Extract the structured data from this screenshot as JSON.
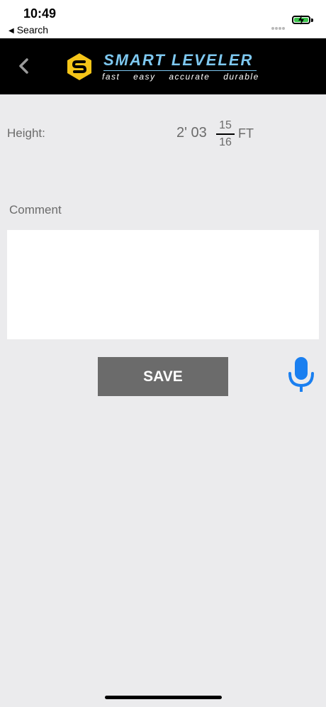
{
  "status_bar": {
    "time": "10:49",
    "back_app_label": "Search",
    "battery_color": "#3ac34a"
  },
  "navbar": {
    "back_icon": "chevron-left-icon",
    "logo": {
      "title": "SMART LEVELER",
      "tagline": "fast easy accurate durable",
      "brand_color": "#7ec8f0",
      "mark_color": "#f5c518"
    }
  },
  "form": {
    "height_label": "Height:",
    "height_value": "2' 03",
    "fraction_numerator": "15",
    "fraction_denominator": "16",
    "height_unit": "FT",
    "comment_label": "Comment",
    "comment_value": "",
    "save_label": "SAVE",
    "mic_icon": "microphone-icon",
    "accent_color": "#1a7ff0"
  }
}
